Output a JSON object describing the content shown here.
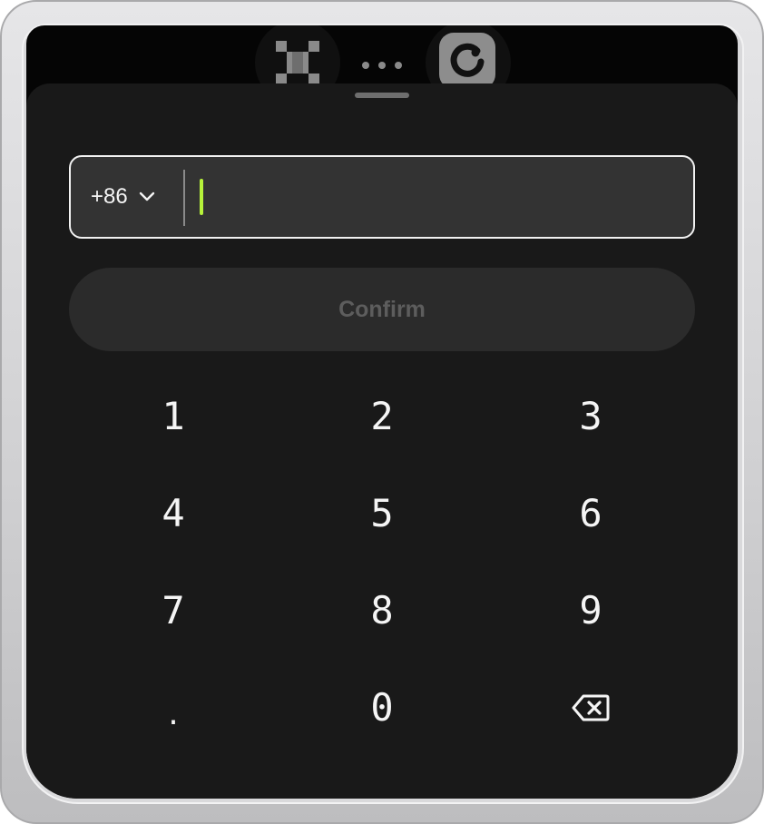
{
  "top_bar": {
    "left_icon": "pixel-x-logo-icon",
    "more_icon": "more-dots-icon",
    "right_icon": "refresh-app-icon"
  },
  "phone_field": {
    "country_code": "+86",
    "dropdown_icon": "chevron-down-icon",
    "value": "",
    "placeholder": "",
    "caret_color": "#b6f23a"
  },
  "confirm_button": {
    "label": "Confirm"
  },
  "keypad": {
    "keys": [
      "1",
      "2",
      "3",
      "4",
      "5",
      "6",
      "7",
      "8",
      "9",
      ".",
      "0"
    ],
    "backspace_icon": "backspace-icon"
  },
  "colors": {
    "sheet_background": "#191919",
    "field_background": "#333333",
    "field_border": "#f2f2f2",
    "confirm_background": "#2b2b2b",
    "confirm_text_disabled": "#5d5d5d",
    "accent": "#b6f23a"
  }
}
